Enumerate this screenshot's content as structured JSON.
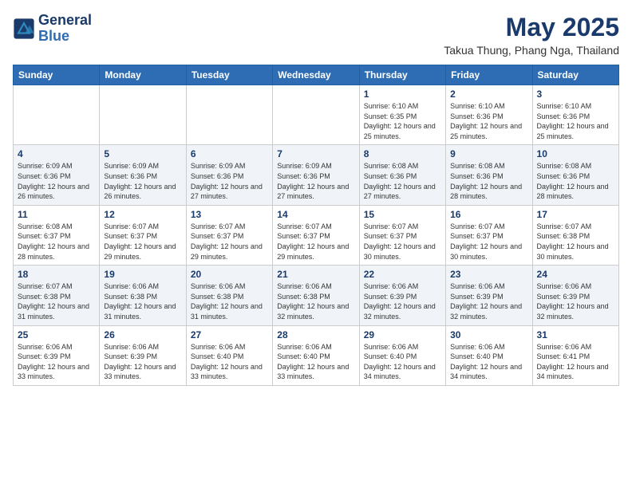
{
  "header": {
    "logo_line1": "General",
    "logo_line2": "Blue",
    "month": "May 2025",
    "location": "Takua Thung, Phang Nga, Thailand"
  },
  "weekdays": [
    "Sunday",
    "Monday",
    "Tuesday",
    "Wednesday",
    "Thursday",
    "Friday",
    "Saturday"
  ],
  "weeks": [
    [
      {
        "day": "",
        "sunrise": "",
        "sunset": "",
        "daylight": ""
      },
      {
        "day": "",
        "sunrise": "",
        "sunset": "",
        "daylight": ""
      },
      {
        "day": "",
        "sunrise": "",
        "sunset": "",
        "daylight": ""
      },
      {
        "day": "",
        "sunrise": "",
        "sunset": "",
        "daylight": ""
      },
      {
        "day": "1",
        "sunrise": "Sunrise: 6:10 AM",
        "sunset": "Sunset: 6:35 PM",
        "daylight": "Daylight: 12 hours and 25 minutes."
      },
      {
        "day": "2",
        "sunrise": "Sunrise: 6:10 AM",
        "sunset": "Sunset: 6:36 PM",
        "daylight": "Daylight: 12 hours and 25 minutes."
      },
      {
        "day": "3",
        "sunrise": "Sunrise: 6:10 AM",
        "sunset": "Sunset: 6:36 PM",
        "daylight": "Daylight: 12 hours and 25 minutes."
      }
    ],
    [
      {
        "day": "4",
        "sunrise": "Sunrise: 6:09 AM",
        "sunset": "Sunset: 6:36 PM",
        "daylight": "Daylight: 12 hours and 26 minutes."
      },
      {
        "day": "5",
        "sunrise": "Sunrise: 6:09 AM",
        "sunset": "Sunset: 6:36 PM",
        "daylight": "Daylight: 12 hours and 26 minutes."
      },
      {
        "day": "6",
        "sunrise": "Sunrise: 6:09 AM",
        "sunset": "Sunset: 6:36 PM",
        "daylight": "Daylight: 12 hours and 27 minutes."
      },
      {
        "day": "7",
        "sunrise": "Sunrise: 6:09 AM",
        "sunset": "Sunset: 6:36 PM",
        "daylight": "Daylight: 12 hours and 27 minutes."
      },
      {
        "day": "8",
        "sunrise": "Sunrise: 6:08 AM",
        "sunset": "Sunset: 6:36 PM",
        "daylight": "Daylight: 12 hours and 27 minutes."
      },
      {
        "day": "9",
        "sunrise": "Sunrise: 6:08 AM",
        "sunset": "Sunset: 6:36 PM",
        "daylight": "Daylight: 12 hours and 28 minutes."
      },
      {
        "day": "10",
        "sunrise": "Sunrise: 6:08 AM",
        "sunset": "Sunset: 6:36 PM",
        "daylight": "Daylight: 12 hours and 28 minutes."
      }
    ],
    [
      {
        "day": "11",
        "sunrise": "Sunrise: 6:08 AM",
        "sunset": "Sunset: 6:37 PM",
        "daylight": "Daylight: 12 hours and 28 minutes."
      },
      {
        "day": "12",
        "sunrise": "Sunrise: 6:07 AM",
        "sunset": "Sunset: 6:37 PM",
        "daylight": "Daylight: 12 hours and 29 minutes."
      },
      {
        "day": "13",
        "sunrise": "Sunrise: 6:07 AM",
        "sunset": "Sunset: 6:37 PM",
        "daylight": "Daylight: 12 hours and 29 minutes."
      },
      {
        "day": "14",
        "sunrise": "Sunrise: 6:07 AM",
        "sunset": "Sunset: 6:37 PM",
        "daylight": "Daylight: 12 hours and 29 minutes."
      },
      {
        "day": "15",
        "sunrise": "Sunrise: 6:07 AM",
        "sunset": "Sunset: 6:37 PM",
        "daylight": "Daylight: 12 hours and 30 minutes."
      },
      {
        "day": "16",
        "sunrise": "Sunrise: 6:07 AM",
        "sunset": "Sunset: 6:37 PM",
        "daylight": "Daylight: 12 hours and 30 minutes."
      },
      {
        "day": "17",
        "sunrise": "Sunrise: 6:07 AM",
        "sunset": "Sunset: 6:38 PM",
        "daylight": "Daylight: 12 hours and 30 minutes."
      }
    ],
    [
      {
        "day": "18",
        "sunrise": "Sunrise: 6:07 AM",
        "sunset": "Sunset: 6:38 PM",
        "daylight": "Daylight: 12 hours and 31 minutes."
      },
      {
        "day": "19",
        "sunrise": "Sunrise: 6:06 AM",
        "sunset": "Sunset: 6:38 PM",
        "daylight": "Daylight: 12 hours and 31 minutes."
      },
      {
        "day": "20",
        "sunrise": "Sunrise: 6:06 AM",
        "sunset": "Sunset: 6:38 PM",
        "daylight": "Daylight: 12 hours and 31 minutes."
      },
      {
        "day": "21",
        "sunrise": "Sunrise: 6:06 AM",
        "sunset": "Sunset: 6:38 PM",
        "daylight": "Daylight: 12 hours and 32 minutes."
      },
      {
        "day": "22",
        "sunrise": "Sunrise: 6:06 AM",
        "sunset": "Sunset: 6:39 PM",
        "daylight": "Daylight: 12 hours and 32 minutes."
      },
      {
        "day": "23",
        "sunrise": "Sunrise: 6:06 AM",
        "sunset": "Sunset: 6:39 PM",
        "daylight": "Daylight: 12 hours and 32 minutes."
      },
      {
        "day": "24",
        "sunrise": "Sunrise: 6:06 AM",
        "sunset": "Sunset: 6:39 PM",
        "daylight": "Daylight: 12 hours and 32 minutes."
      }
    ],
    [
      {
        "day": "25",
        "sunrise": "Sunrise: 6:06 AM",
        "sunset": "Sunset: 6:39 PM",
        "daylight": "Daylight: 12 hours and 33 minutes."
      },
      {
        "day": "26",
        "sunrise": "Sunrise: 6:06 AM",
        "sunset": "Sunset: 6:39 PM",
        "daylight": "Daylight: 12 hours and 33 minutes."
      },
      {
        "day": "27",
        "sunrise": "Sunrise: 6:06 AM",
        "sunset": "Sunset: 6:40 PM",
        "daylight": "Daylight: 12 hours and 33 minutes."
      },
      {
        "day": "28",
        "sunrise": "Sunrise: 6:06 AM",
        "sunset": "Sunset: 6:40 PM",
        "daylight": "Daylight: 12 hours and 33 minutes."
      },
      {
        "day": "29",
        "sunrise": "Sunrise: 6:06 AM",
        "sunset": "Sunset: 6:40 PM",
        "daylight": "Daylight: 12 hours and 34 minutes."
      },
      {
        "day": "30",
        "sunrise": "Sunrise: 6:06 AM",
        "sunset": "Sunset: 6:40 PM",
        "daylight": "Daylight: 12 hours and 34 minutes."
      },
      {
        "day": "31",
        "sunrise": "Sunrise: 6:06 AM",
        "sunset": "Sunset: 6:41 PM",
        "daylight": "Daylight: 12 hours and 34 minutes."
      }
    ]
  ]
}
